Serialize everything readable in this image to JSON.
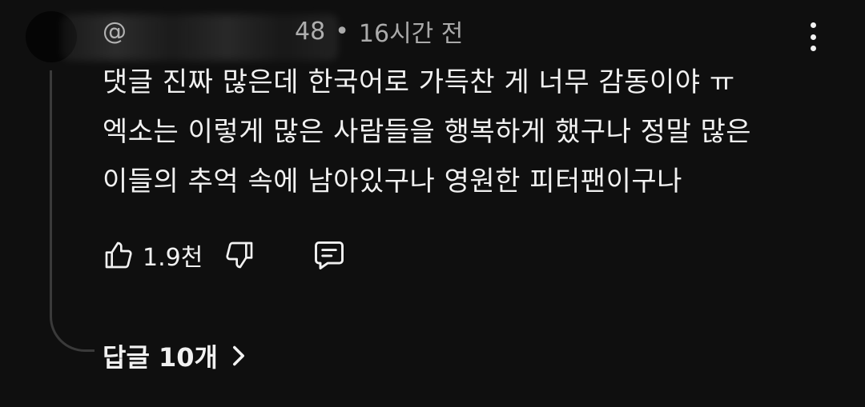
{
  "comment": {
    "author_visible_fragment": "@",
    "author_visible_tail": "48",
    "separator": "•",
    "time": "16시간 전",
    "lines": [
      "댓글 진짜 많은데 한국어로 가득찬 게 너무 감동이야 ㅠ",
      "엑소는 이렇게 많은 사람들을 행복하게 했구나 정말 많은",
      "이들의 추억 속에 남아있구나 영원한 피터팬이구나"
    ],
    "likes": "1.9천",
    "replies_label": "답글 10개"
  },
  "icons": {
    "menu": "more-vert-icon",
    "like": "thumbs-up-icon",
    "dislike": "thumbs-down-icon",
    "reply": "comment-icon",
    "replies": "chevron-right-icon"
  },
  "colors": {
    "background": "#0f0f0f",
    "text": "#f1f1f1",
    "muted": "#aaaaaa",
    "thread_line": "#3a3a3a"
  }
}
